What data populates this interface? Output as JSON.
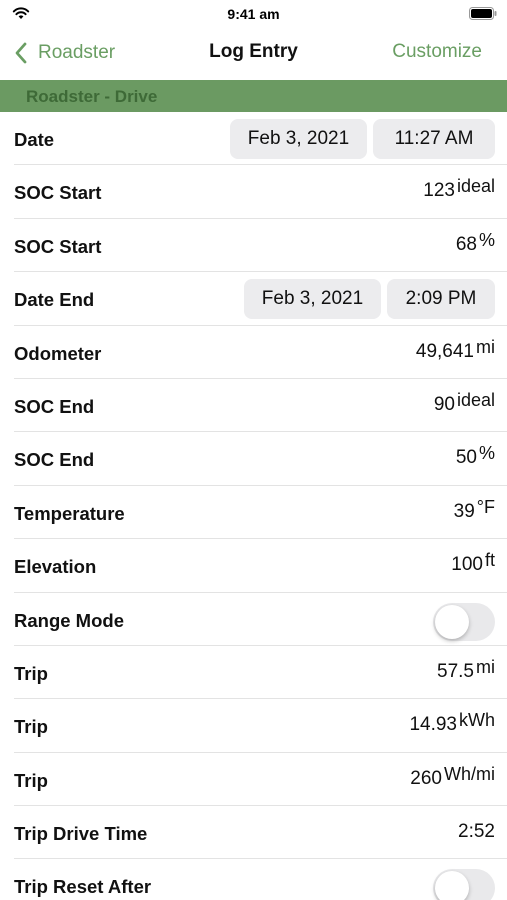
{
  "status_bar": {
    "time": "9:41 am"
  },
  "nav": {
    "back_label": "Roadster",
    "title": "Log Entry",
    "customize_label": "Customize"
  },
  "section": {
    "title": "Roadster - Drive"
  },
  "rows": {
    "date": {
      "label": "Date",
      "date": "Feb 3, 2021",
      "time": "11:27 AM"
    },
    "soc_start_ideal": {
      "label": "SOC Start",
      "value": "123",
      "unit": "ideal"
    },
    "soc_start_pct": {
      "label": "SOC Start",
      "value": "68",
      "unit": "%"
    },
    "date_end": {
      "label": "Date End",
      "date": "Feb 3, 2021",
      "time": "2:09 PM"
    },
    "odometer": {
      "label": "Odometer",
      "value": "49,641",
      "unit": "mi"
    },
    "soc_end_ideal": {
      "label": "SOC End",
      "value": "90",
      "unit": "ideal"
    },
    "soc_end_pct": {
      "label": "SOC End",
      "value": "50",
      "unit": "%"
    },
    "temperature": {
      "label": "Temperature",
      "value": "39",
      "unit": "°F"
    },
    "elevation": {
      "label": "Elevation",
      "value": "100",
      "unit": "ft"
    },
    "range_mode": {
      "label": "Range Mode",
      "on": false
    },
    "trip_distance": {
      "label": "Trip",
      "value": "57.5",
      "unit": "mi"
    },
    "trip_energy": {
      "label": "Trip",
      "value": "14.93",
      "unit": "kWh"
    },
    "trip_efficiency": {
      "label": "Trip",
      "value": "260",
      "unit": "Wh/mi"
    },
    "trip_drive_time": {
      "label": "Trip Drive Time",
      "value": "2:52"
    },
    "trip_reset_after": {
      "label": "Trip Reset After",
      "on": false
    }
  },
  "colors": {
    "accent": "#6a9e63",
    "section_bg": "#6b9a62",
    "section_text": "#3e6a37",
    "pill_bg": "#ececee",
    "toggle_off": "#e9e9eb"
  }
}
